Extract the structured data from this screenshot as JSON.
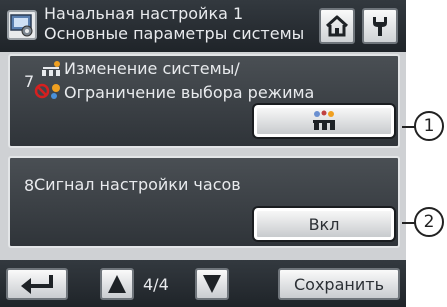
{
  "header": {
    "title_line1": "Начальная настройка 1",
    "title_line2": "Основные параметры системы",
    "settings_icon": "settings-screen-icon",
    "home_icon": "home-icon",
    "service_icon": "wrench-icon"
  },
  "items": [
    {
      "number": "7",
      "label_line1": "Изменение системы/",
      "label_line2": "Ограничение выбора режима",
      "button_icon": "system-mode-icon"
    },
    {
      "number": "8",
      "label": "Сигнал настройки часов",
      "button_label": "Вкл"
    }
  ],
  "footer": {
    "back_icon": "return-arrow-icon",
    "up_icon": "up-triangle-icon",
    "page_indicator": "4/4",
    "down_icon": "down-triangle-icon",
    "save_label": "Сохранить"
  },
  "callouts": [
    "1",
    "2"
  ],
  "colors": {
    "bar": "#2a2f34",
    "panel": "#3c4146",
    "screen_bg": "#cfd1d4",
    "button": "#e6e7e9",
    "accent_orange": "#f0a020",
    "accent_red": "#d62020"
  }
}
